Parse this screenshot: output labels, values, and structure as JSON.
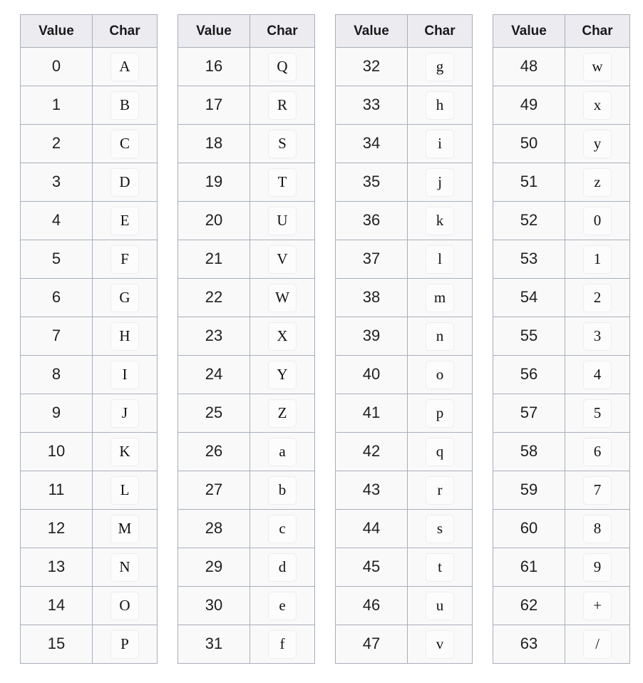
{
  "tables": [
    {
      "name": "base64-values-0-15",
      "headers": {
        "value": "Value",
        "char": "Char"
      },
      "rows": [
        {
          "value": "0",
          "char": "A"
        },
        {
          "value": "1",
          "char": "B"
        },
        {
          "value": "2",
          "char": "C"
        },
        {
          "value": "3",
          "char": "D"
        },
        {
          "value": "4",
          "char": "E"
        },
        {
          "value": "5",
          "char": "F"
        },
        {
          "value": "6",
          "char": "G"
        },
        {
          "value": "7",
          "char": "H"
        },
        {
          "value": "8",
          "char": "I"
        },
        {
          "value": "9",
          "char": "J"
        },
        {
          "value": "10",
          "char": "K"
        },
        {
          "value": "11",
          "char": "L"
        },
        {
          "value": "12",
          "char": "M"
        },
        {
          "value": "13",
          "char": "N"
        },
        {
          "value": "14",
          "char": "O"
        },
        {
          "value": "15",
          "char": "P"
        }
      ]
    },
    {
      "name": "base64-values-16-31",
      "headers": {
        "value": "Value",
        "char": "Char"
      },
      "rows": [
        {
          "value": "16",
          "char": "Q"
        },
        {
          "value": "17",
          "char": "R"
        },
        {
          "value": "18",
          "char": "S"
        },
        {
          "value": "19",
          "char": "T"
        },
        {
          "value": "20",
          "char": "U"
        },
        {
          "value": "21",
          "char": "V"
        },
        {
          "value": "22",
          "char": "W"
        },
        {
          "value": "23",
          "char": "X"
        },
        {
          "value": "24",
          "char": "Y"
        },
        {
          "value": "25",
          "char": "Z"
        },
        {
          "value": "26",
          "char": "a"
        },
        {
          "value": "27",
          "char": "b"
        },
        {
          "value": "28",
          "char": "c"
        },
        {
          "value": "29",
          "char": "d"
        },
        {
          "value": "30",
          "char": "e"
        },
        {
          "value": "31",
          "char": "f"
        }
      ]
    },
    {
      "name": "base64-values-32-47",
      "headers": {
        "value": "Value",
        "char": "Char"
      },
      "rows": [
        {
          "value": "32",
          "char": "g"
        },
        {
          "value": "33",
          "char": "h"
        },
        {
          "value": "34",
          "char": "i"
        },
        {
          "value": "35",
          "char": "j"
        },
        {
          "value": "36",
          "char": "k"
        },
        {
          "value": "37",
          "char": "l"
        },
        {
          "value": "38",
          "char": "m"
        },
        {
          "value": "39",
          "char": "n"
        },
        {
          "value": "40",
          "char": "o"
        },
        {
          "value": "41",
          "char": "p"
        },
        {
          "value": "42",
          "char": "q"
        },
        {
          "value": "43",
          "char": "r"
        },
        {
          "value": "44",
          "char": "s"
        },
        {
          "value": "45",
          "char": "t"
        },
        {
          "value": "46",
          "char": "u"
        },
        {
          "value": "47",
          "char": "v"
        }
      ]
    },
    {
      "name": "base64-values-48-63",
      "headers": {
        "value": "Value",
        "char": "Char"
      },
      "rows": [
        {
          "value": "48",
          "char": "w"
        },
        {
          "value": "49",
          "char": "x"
        },
        {
          "value": "50",
          "char": "y"
        },
        {
          "value": "51",
          "char": "z"
        },
        {
          "value": "52",
          "char": "0"
        },
        {
          "value": "53",
          "char": "1"
        },
        {
          "value": "54",
          "char": "2"
        },
        {
          "value": "55",
          "char": "3"
        },
        {
          "value": "56",
          "char": "4"
        },
        {
          "value": "57",
          "char": "5"
        },
        {
          "value": "58",
          "char": "6"
        },
        {
          "value": "59",
          "char": "7"
        },
        {
          "value": "60",
          "char": "8"
        },
        {
          "value": "61",
          "char": "9"
        },
        {
          "value": "62",
          "char": "+"
        },
        {
          "value": "63",
          "char": "/"
        }
      ]
    }
  ],
  "colors": {
    "header_background": "#ecebf0",
    "cell_background": "#f9f9fa",
    "border": "#a9aeb9",
    "char_box_border": "#ededf1",
    "char_box_background": "#fcfcfd",
    "text": "#1a1a1a",
    "page_background": "#ffffff"
  }
}
